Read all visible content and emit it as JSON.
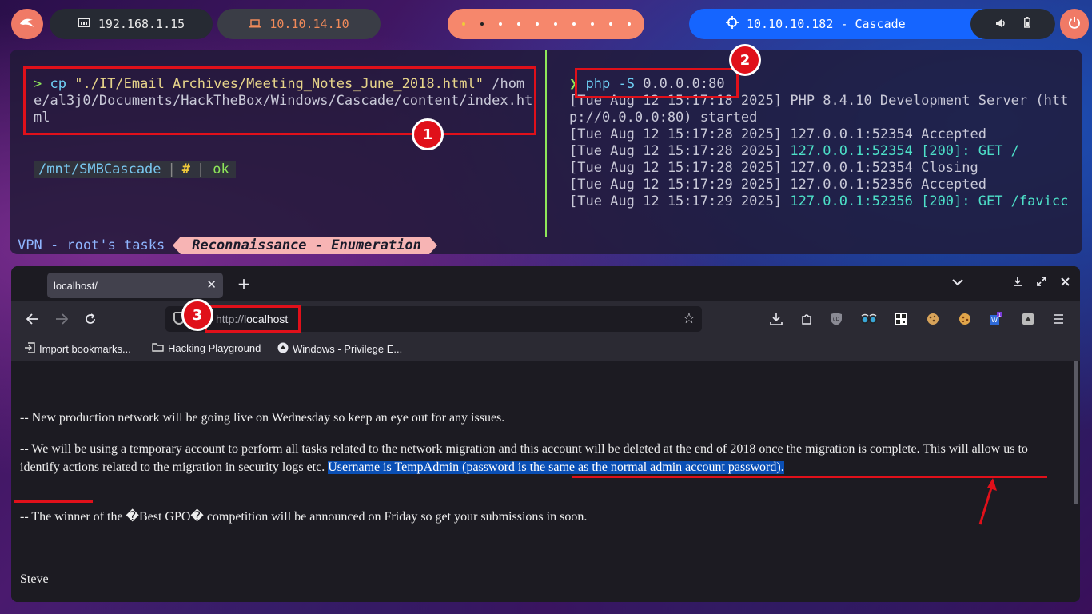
{
  "topbar": {
    "ip_local": "192.168.1.15",
    "ip_vpn": "10.10.14.10",
    "target": "10.10.10.182 - Cascade",
    "workspace_dots": 8,
    "active_workspace": 2
  },
  "terminal": {
    "left": {
      "prompt": ">",
      "cmd_word": "cp",
      "cmd_arg_quoted": "\"./IT/Email Archives/Meeting_Notes_June_2018.html\"",
      "cmd_arg_rest": " /home/al3j0/Documents/HackTheBox/Windows/Cascade/content/index.html",
      "status_path": "/mnt/SMBCascade",
      "status_sep": "|",
      "status_hash": "#",
      "status_ok": "ok"
    },
    "right": {
      "prompt": "❯",
      "cmd_word": "php",
      "cmd_flag": "-S",
      "cmd_arg": "0.0.0.0:80",
      "lines": [
        {
          "ts": "[Tue Aug 12 15:17:18 2025]",
          "msg": " PHP 8.4.10 Development Server (http://0.0.0.0:80) started",
          "color": "plain"
        },
        {
          "ts": "[Tue Aug 12 15:17:28 2025]",
          "msg": " 127.0.0.1:52354 Accepted",
          "color": "plain"
        },
        {
          "ts": "[Tue Aug 12 15:17:28 2025]",
          "msg": " 127.0.0.1:52354 [200]: GET /",
          "color": "cyan"
        },
        {
          "ts": "[Tue Aug 12 15:17:28 2025]",
          "msg": " 127.0.0.1:52354 Closing",
          "color": "plain"
        },
        {
          "ts": "[Tue Aug 12 15:17:29 2025]",
          "msg": " 127.0.0.1:52356 Accepted",
          "color": "plain"
        },
        {
          "ts": "[Tue Aug 12 15:17:29 2025]",
          "msg": " 127.0.0.1:52356 [200]: GET /favicc",
          "color": "cyan"
        }
      ]
    },
    "tmux": {
      "session": "VPN - root's tasks",
      "window": "Reconnaissance - Enumeration"
    }
  },
  "browser": {
    "tab_title": "localhost/",
    "url_proto": "http://",
    "url_host": "localhost",
    "bookmarks": [
      "Import bookmarks...",
      "Hacking Playground",
      "Windows - Privilege E..."
    ],
    "content": {
      "p1": "-- New production network will be going live on Wednesday so keep an eye out for any issues.",
      "p2_plain": "-- We will be using a temporary account to perform all tasks related to the network migration and this account will be deleted at the end of 2018 once the migration is complete. This will allow us to identify actions related to the migration in security logs etc. ",
      "p2_highlight": "Username is TempAdmin (password is the same as the normal admin account password).",
      "p3": "-- The winner of the �Best GPO� competition will be announced on Friday so get your submissions in soon.",
      "signature": "Steve"
    }
  },
  "annotations": {
    "n1": "1",
    "n2": "2",
    "n3": "3"
  },
  "colors": {
    "annotation_red": "#e0101a",
    "highlight_blue": "#0a4fb5",
    "terminal_green": "#8ee65a",
    "terminal_cyan": "#4de0c8",
    "target_blue": "#1565ff",
    "accent_salmon": "#f07a66"
  }
}
